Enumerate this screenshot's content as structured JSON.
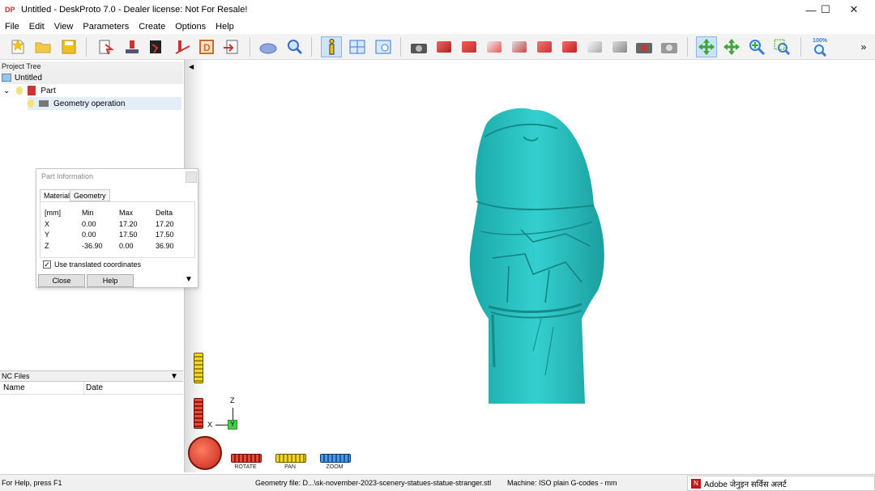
{
  "window": {
    "title": "Untitled - DeskProto 7.0 - Dealer license: Not For Resale!",
    "logo": "DP",
    "minimize": "—",
    "maximize": "☐",
    "close": "✕"
  },
  "menu": [
    "File",
    "Edit",
    "View",
    "Parameters",
    "Create",
    "Options",
    "Help"
  ],
  "toolbar": {
    "zoom_level": "100%",
    "overflow": "»",
    "icons": [
      "new-project-icon",
      "open-folder-icon",
      "save-disk-icon",
      "part-import-icon",
      "geometry-icon",
      "bitmap-icon",
      "vector-icon",
      "drawing-icon",
      "export-icon",
      "simulation-icon",
      "preview-icon",
      "info-icon",
      "window-tile-icon",
      "viewport-icon",
      "camera-icon",
      "view-front-icon",
      "view-right-icon",
      "view-top-icon",
      "view-iso-icon",
      "view-back-icon",
      "view-left-icon",
      "view-bottom-icon",
      "view-cube-icon",
      "view-gray-icon",
      "snapshot-icon",
      "snapshot-alt-icon",
      "rotate-view-icon",
      "pan-view-icon",
      "zoom-in-icon",
      "zoom-window-icon",
      "zoom-fit-icon"
    ],
    "cube_colors": [
      "#d9534f",
      "#e04a3f",
      "#e35b52",
      "#d0413a",
      "#c94a43",
      "#d54c44",
      "#e0e0e0",
      "#bdbdbd"
    ]
  },
  "project_tree": {
    "header": "Project Tree",
    "root": "Untitled",
    "part": "Part",
    "operation": "Geometry operation"
  },
  "nc_files": {
    "header": "NC Files",
    "col_name": "Name",
    "col_date": "Date"
  },
  "part_info": {
    "title": "Part Information",
    "tabs": [
      "Material",
      "Geometry"
    ],
    "headers": [
      "[mm]",
      "Min",
      "Max",
      "Delta"
    ],
    "rows": [
      {
        "axis": "X",
        "min": "0.00",
        "max": "17.20",
        "delta": "17.20"
      },
      {
        "axis": "Y",
        "min": "0.00",
        "max": "17.50",
        "delta": "17.50"
      },
      {
        "axis": "Z",
        "min": "-36.90",
        "max": "0.00",
        "delta": "36.90"
      }
    ],
    "checkbox": "Use translated coordinates",
    "close": "Close",
    "help": "Help"
  },
  "viewport": {
    "axis_z": "Z",
    "axis_x": "X",
    "axis_y": "Y",
    "view_controls": [
      "ROTATE",
      "PAN",
      "ZOOM"
    ],
    "model_color": "#2ec4c4"
  },
  "status": {
    "help": "For Help, press F1",
    "geometry": "Geometry file: D...\\sk-november-2023-scenery-statues-statue-stranger.stl",
    "machine": "Machine: ISO plain G-codes - mm",
    "alert": "Adobe जेनुइन सर्विस अलर्ट",
    "alert_icon": "N"
  }
}
